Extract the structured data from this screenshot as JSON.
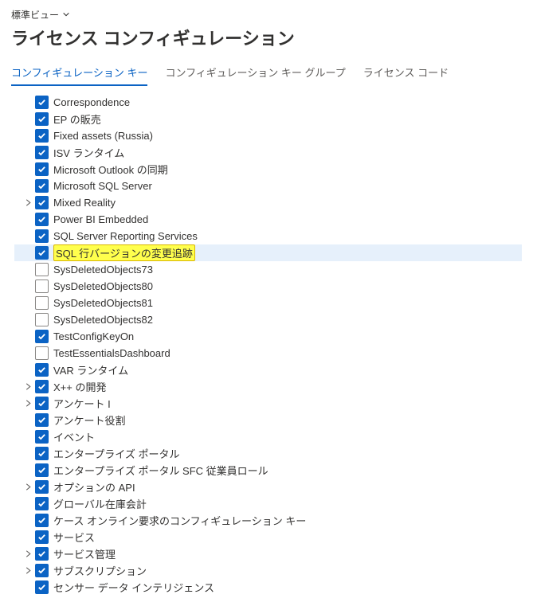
{
  "view_selector": "標準ビュー",
  "page_title": "ライセンス コンフィギュレーション",
  "tabs": [
    {
      "label": "コンフィギュレーション キー",
      "active": true
    },
    {
      "label": "コンフィギュレーション キー グループ",
      "active": false
    },
    {
      "label": "ライセンス コード",
      "active": false
    }
  ],
  "items": [
    {
      "label": "Correspondence",
      "checked": true,
      "expandable": false,
      "selected": false,
      "highlight": false
    },
    {
      "label": "EP の販売",
      "checked": true,
      "expandable": false,
      "selected": false,
      "highlight": false
    },
    {
      "label": "Fixed assets (Russia)",
      "checked": true,
      "expandable": false,
      "selected": false,
      "highlight": false
    },
    {
      "label": "ISV ランタイム",
      "checked": true,
      "expandable": false,
      "selected": false,
      "highlight": false
    },
    {
      "label": "Microsoft Outlook の同期",
      "checked": true,
      "expandable": false,
      "selected": false,
      "highlight": false
    },
    {
      "label": "Microsoft SQL Server",
      "checked": true,
      "expandable": false,
      "selected": false,
      "highlight": false
    },
    {
      "label": "Mixed Reality",
      "checked": true,
      "expandable": true,
      "selected": false,
      "highlight": false
    },
    {
      "label": "Power BI Embedded",
      "checked": true,
      "expandable": false,
      "selected": false,
      "highlight": false
    },
    {
      "label": "SQL Server Reporting Services",
      "checked": true,
      "expandable": false,
      "selected": false,
      "highlight": false
    },
    {
      "label": "SQL 行バージョンの変更追跡",
      "checked": true,
      "expandable": false,
      "selected": true,
      "highlight": true
    },
    {
      "label": "SysDeletedObjects73",
      "checked": false,
      "expandable": false,
      "selected": false,
      "highlight": false
    },
    {
      "label": "SysDeletedObjects80",
      "checked": false,
      "expandable": false,
      "selected": false,
      "highlight": false
    },
    {
      "label": "SysDeletedObjects81",
      "checked": false,
      "expandable": false,
      "selected": false,
      "highlight": false
    },
    {
      "label": "SysDeletedObjects82",
      "checked": false,
      "expandable": false,
      "selected": false,
      "highlight": false
    },
    {
      "label": "TestConfigKeyOn",
      "checked": true,
      "expandable": false,
      "selected": false,
      "highlight": false
    },
    {
      "label": "TestEssentialsDashboard",
      "checked": false,
      "expandable": false,
      "selected": false,
      "highlight": false
    },
    {
      "label": "VAR ランタイム",
      "checked": true,
      "expandable": false,
      "selected": false,
      "highlight": false
    },
    {
      "label": "X++ の開発",
      "checked": true,
      "expandable": true,
      "selected": false,
      "highlight": false
    },
    {
      "label": "アンケート I",
      "checked": true,
      "expandable": true,
      "selected": false,
      "highlight": false
    },
    {
      "label": "アンケート役割",
      "checked": true,
      "expandable": false,
      "selected": false,
      "highlight": false
    },
    {
      "label": "イベント",
      "checked": true,
      "expandable": false,
      "selected": false,
      "highlight": false
    },
    {
      "label": "エンタープライズ ポータル",
      "checked": true,
      "expandable": false,
      "selected": false,
      "highlight": false
    },
    {
      "label": "エンタープライズ ポータル SFC 従業員ロール",
      "checked": true,
      "expandable": false,
      "selected": false,
      "highlight": false
    },
    {
      "label": "オプションの API",
      "checked": true,
      "expandable": true,
      "selected": false,
      "highlight": false
    },
    {
      "label": "グローバル在庫会計",
      "checked": true,
      "expandable": false,
      "selected": false,
      "highlight": false
    },
    {
      "label": "ケース オンライン要求のコンフィギュレーション キー",
      "checked": true,
      "expandable": false,
      "selected": false,
      "highlight": false
    },
    {
      "label": "サービス",
      "checked": true,
      "expandable": false,
      "selected": false,
      "highlight": false
    },
    {
      "label": "サービス管理",
      "checked": true,
      "expandable": true,
      "selected": false,
      "highlight": false
    },
    {
      "label": "サブスクリプション",
      "checked": true,
      "expandable": true,
      "selected": false,
      "highlight": false
    },
    {
      "label": "センサー データ インテリジェンス",
      "checked": true,
      "expandable": false,
      "selected": false,
      "highlight": false
    }
  ]
}
